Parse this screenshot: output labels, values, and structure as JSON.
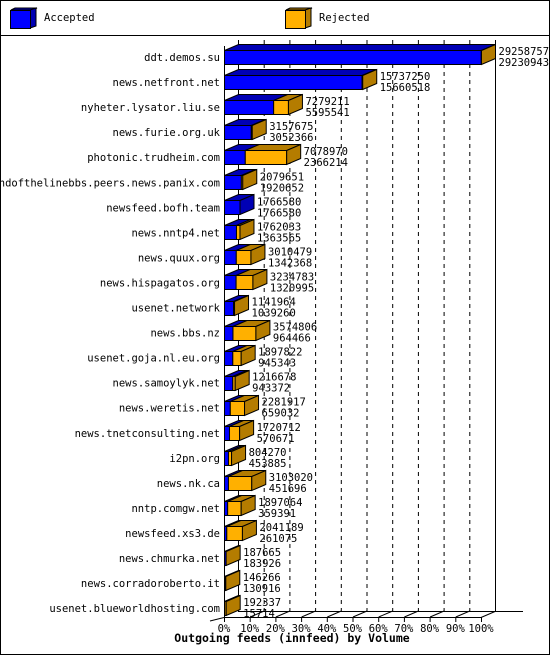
{
  "legend": {
    "accepted_label": "Accepted",
    "rejected_label": "Rejected"
  },
  "colors": {
    "accepted_front": "#0000ff",
    "accepted_top": "#0000b4",
    "rejected_front": "#ffb000",
    "rejected_top": "#b47c00"
  },
  "chart_data": {
    "type": "bar",
    "orientation": "horizontal",
    "stacked": true,
    "three_d": true,
    "title": "Outgoing feeds (innfeed) by Volume",
    "xlabel": "",
    "ylabel": "",
    "x_ticks": [
      "0%",
      "10%",
      "20%",
      "30%",
      "40%",
      "50%",
      "60%",
      "70%",
      "80%",
      "90%",
      "100%"
    ],
    "xlim": [
      0,
      100
    ],
    "grid": "vertical dashed",
    "legend_position": "top",
    "categories": [
      "ddt.demos.su",
      "news.netfront.net",
      "nyheter.lysator.liu.se",
      "news.furie.org.uk",
      "photonic.trudheim.com",
      "endofthelinebbs.peers.news.panix.com",
      "newsfeed.bofh.team",
      "news.nntp4.net",
      "news.quux.org",
      "news.hispagatos.org",
      "usenet.network",
      "news.bbs.nz",
      "usenet.goja.nl.eu.org",
      "news.samoylyk.net",
      "news.weretis.net",
      "news.tnetconsulting.net",
      "i2pn.org",
      "news.nk.ca",
      "nntp.comgw.net",
      "newsfeed.xs3.de",
      "news.chmurka.net",
      "news.corradoroberto.it",
      "usenet.blueworldhosting.com"
    ],
    "totals": [
      29258757,
      15737250,
      7279211,
      3157675,
      7078970,
      2079651,
      1766580,
      1762033,
      3010479,
      3234783,
      1141964,
      3574806,
      1897822,
      1216678,
      2281917,
      1720712,
      804270,
      3103020,
      1897064,
      2041189,
      187665,
      146266,
      192337
    ],
    "series": [
      {
        "name": "Accepted",
        "values": [
          29230943,
          15660518,
          5595541,
          3052366,
          2366214,
          1920652,
          1766580,
          1363565,
          1342368,
          1320995,
          1039260,
          964466,
          945343,
          943372,
          659032,
          570671,
          453885,
          451696,
          359391,
          261075,
          183926,
          130916,
          15714
        ]
      },
      {
        "name": "Rejected",
        "values": [
          27814,
          76732,
          1683670,
          105309,
          4712756,
          158999,
          0,
          398468,
          1668111,
          1913788,
          102704,
          2610340,
          952479,
          273306,
          1622885,
          1150041,
          350385,
          2651324,
          1537673,
          1780114,
          3739,
          15350,
          176623
        ]
      }
    ]
  }
}
